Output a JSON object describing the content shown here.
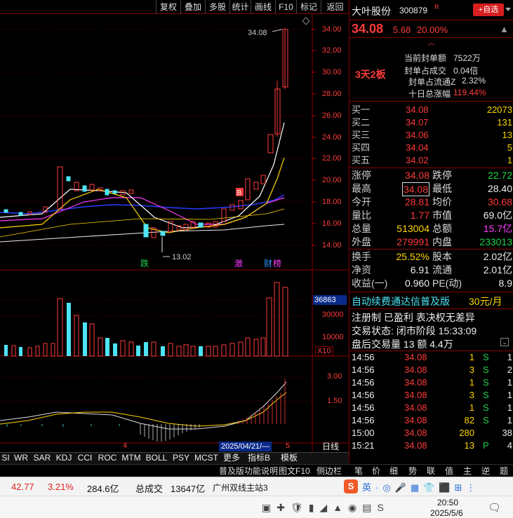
{
  "toolbar": [
    "复权",
    "叠加",
    "多股",
    "统计",
    "画线",
    "F10",
    "标记",
    "返回"
  ],
  "stock": {
    "name": "大叶股份",
    "code": "300879",
    "tag": "R",
    "price": "34.08",
    "change": "5.68",
    "pct": "20.00%",
    "add_btn": "+自选"
  },
  "seal": {
    "limit_label": "3天2板",
    "rows": [
      {
        "k": "当前封单额",
        "v": "7522万"
      },
      {
        "k": "封单占成交",
        "v": "0.04倍"
      },
      {
        "k": "封单占流通Z",
        "v": "2.32%"
      },
      {
        "k": "十日总涨幅",
        "v": "119.44%"
      }
    ]
  },
  "orderbook": [
    {
      "k": "买一",
      "p": "34.08",
      "v": "22073"
    },
    {
      "k": "买二",
      "p": "34.07",
      "v": "131"
    },
    {
      "k": "买三",
      "p": "34.06",
      "v": "13"
    },
    {
      "k": "买四",
      "p": "34.04",
      "v": "5"
    },
    {
      "k": "买五",
      "p": "34.02",
      "v": "1"
    }
  ],
  "quote": [
    {
      "k1": "涨停",
      "v1": "34.08",
      "k2": "跌停",
      "v2": "22.72"
    },
    {
      "k1": "最高",
      "v1": "34.08",
      "k2": "最低",
      "v2": "28.40"
    },
    {
      "k1": "今开",
      "v1": "28.81",
      "k2": "均价",
      "v2": "30.68"
    },
    {
      "k1": "量比",
      "v1": "1.77",
      "k2": "市值",
      "v2": "69.0亿"
    },
    {
      "k1": "总量",
      "v1": "513004",
      "k2": "总额",
      "v2": "15.7亿"
    },
    {
      "k1": "外盘",
      "v1": "279991",
      "k2": "内盘",
      "v2": "233013"
    }
  ],
  "fin": [
    {
      "k1": "换手",
      "v1": "25.52%",
      "k2": "股本",
      "v2": "2.02亿"
    },
    {
      "k1": "净资",
      "v1": "6.91",
      "k2": "流通",
      "v2": "2.01亿"
    },
    {
      "k1": "收益(一)",
      "v1": "0.960",
      "k2": "PE(动)",
      "v2": "8.9"
    }
  ],
  "promo": {
    "text": "自动续费通达信普及版",
    "price": "30元/月"
  },
  "reg": "注册制 已盈利 表决权无差异",
  "status": "交易状态: 闭市阶段 15:33:09",
  "after": "盘后交易量 13 额 4.4万",
  "ticks": [
    {
      "t": "14:56",
      "p": "34.08",
      "v": "1",
      "s": "S",
      "n": "1"
    },
    {
      "t": "14:56",
      "p": "34.08",
      "v": "3",
      "s": "S",
      "n": "2"
    },
    {
      "t": "14:56",
      "p": "34.08",
      "v": "1",
      "s": "S",
      "n": "1"
    },
    {
      "t": "14:56",
      "p": "34.08",
      "v": "3",
      "s": "S",
      "n": "1"
    },
    {
      "t": "14:56",
      "p": "34.08",
      "v": "1",
      "s": "S",
      "n": "1"
    },
    {
      "t": "14:56",
      "p": "34.08",
      "v": "82",
      "s": "S",
      "n": "1"
    },
    {
      "t": "15:00",
      "p": "34.08",
      "v": "280",
      "s": "",
      "n": "38"
    },
    {
      "t": "15:21",
      "p": "34.08",
      "v": "13",
      "s": "P",
      "n": "4"
    }
  ],
  "axis_price": [
    "34.00",
    "32.00",
    "30.00",
    "28.00",
    "26.00",
    "24.00",
    "22.00",
    "20.00",
    "18.00",
    "16.00",
    "14.00"
  ],
  "axis_vol": [
    "36863",
    "30000",
    "10000",
    "X10"
  ],
  "axis_macd": [
    "3.00",
    "1.50"
  ],
  "chart_labels": {
    "high": "34.08",
    "low": "13.02",
    "die": "跌",
    "ji": "激",
    "cai": "财",
    "bang": "榜",
    "B": "B"
  },
  "date_label": "2025/04/21/—",
  "date_x": "4",
  "date_5": "5",
  "ri": "日线",
  "indicators": [
    "SI",
    "WR",
    "SAR",
    "KDJ",
    "CCI",
    "ROC",
    "MTM",
    "BOLL",
    "PSY",
    "MCST",
    "更多",
    "指标B",
    "模板"
  ],
  "bottom_right": [
    "普及版功能说明",
    "图文F10",
    "侧边栏",
    "笔",
    "价",
    "细",
    "势",
    "联",
    "值",
    "主",
    "逆",
    "题"
  ],
  "statusbar": {
    "price": "42.77",
    "pct": "3.21%",
    "amount": "284.6亿",
    "vol_lbl": "总成交",
    "vol": "13647亿",
    "server": "广州双线主站3"
  },
  "clock": {
    "time": "20:50",
    "date": "2025/5/6"
  }
}
